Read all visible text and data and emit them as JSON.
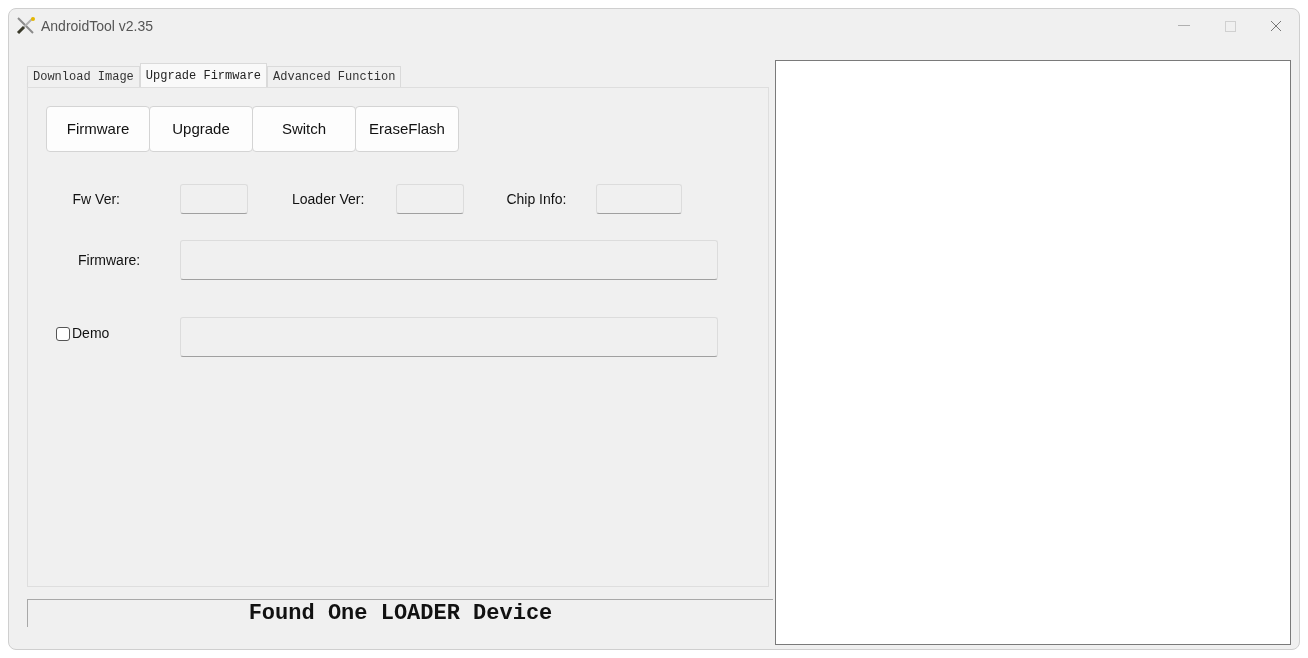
{
  "window": {
    "title": "AndroidTool v2.35"
  },
  "tabs": [
    {
      "label": "Download Image",
      "selected": false
    },
    {
      "label": "Upgrade Firmware",
      "selected": true
    },
    {
      "label": "Advanced Function",
      "selected": false
    }
  ],
  "buttons": [
    "Firmware",
    "Upgrade",
    "Switch",
    "EraseFlash"
  ],
  "info_fields": [
    {
      "label": "Fw Ver:"
    },
    {
      "label": "Loader Ver:"
    },
    {
      "label": "Chip Info:"
    }
  ],
  "firmware_field": {
    "label": "Firmware:"
  },
  "demo": {
    "label": "Demo",
    "checked": false
  },
  "status_bar": "Found One LOADER Device"
}
